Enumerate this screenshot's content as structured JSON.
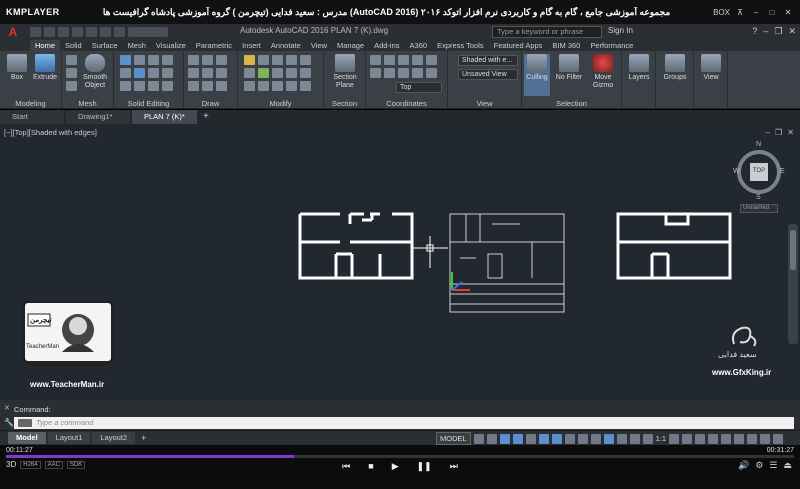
{
  "player": {
    "logo": "KMPLAYER",
    "title": "مجموعه آموزشی جامع ، گام به گام و کاربردی نرم افزار  اتوکد ۲۰۱۶  (AutoCAD 2016)  مدرس : سعید فدایی (تیچرمن ) گروه آموزشی پادشاه گرافیست ها",
    "badge": "BOX",
    "time_current": "00:11:27",
    "time_total": "00:31:27",
    "progress_fraction": 0.365,
    "progress_color": "#7b3bd1",
    "bottom_left_tags": [
      "H264",
      "AAC",
      "SDK"
    ]
  },
  "app": {
    "logo_glyph": "A",
    "document_title": "Autodesk AutoCAD 2016    PLAN 7 (K).dwg",
    "search_placeholder": "Type a keyword or phrase",
    "sign_in": "Sign In",
    "accent_color": "#e2322f"
  },
  "ribbon_tabs": [
    "Home",
    "Solid",
    "Surface",
    "Mesh",
    "Visualize",
    "Parametric",
    "Insert",
    "Annotate",
    "View",
    "Manage",
    "Add-ins",
    "A360",
    "Express Tools",
    "Featured Apps",
    "BIM 360",
    "Performance"
  ],
  "ribbon": {
    "modeling": {
      "label": "Modeling",
      "box": "Box",
      "extrude": "Extrude"
    },
    "mesh": {
      "label": "Mesh",
      "smooth": "Smooth Object"
    },
    "solid_editing": {
      "label": "Solid Editing"
    },
    "draw": {
      "label": "Draw"
    },
    "modify": {
      "label": "Modify"
    },
    "section": {
      "label": "Section",
      "plane": "Section Plane"
    },
    "coordinates": {
      "label": "Coordinates",
      "view_dd": "Top"
    },
    "view": {
      "label": "View",
      "visual_style": "Shaded with e...",
      "saved_view": "Unsaved View"
    },
    "selection": {
      "label": "Selection",
      "culling": "Culling",
      "no_filter": "No Filter",
      "move_gizmo": "Move Gizmo"
    },
    "layers": "Layers",
    "groups": "Groups",
    "view_btn": "View"
  },
  "file_tabs": [
    "Start",
    "Drawing1*",
    "PLAN 7 (K)*"
  ],
  "viewport": {
    "label": "[−][Top][Shaded with edges]",
    "viewcube": {
      "top": "TOP",
      "n": "N",
      "s": "S",
      "e": "E",
      "w": "W"
    },
    "named_view": "Unnamed",
    "watermark_left_url": "www.TeacherMan.ir",
    "watermark_right_url": "www.GfxKing.ir",
    "watermark_right_name": "سعید فدایی",
    "teacher_badge_text": "تیچرمن",
    "teacher_badge_sub": "TeacherMan"
  },
  "command": {
    "history": "Command:",
    "placeholder": "Type a command"
  },
  "status": {
    "layout_tabs": [
      "Model",
      "Layout1",
      "Layout2"
    ],
    "model_btn": "MODEL",
    "scale": "1:1"
  }
}
